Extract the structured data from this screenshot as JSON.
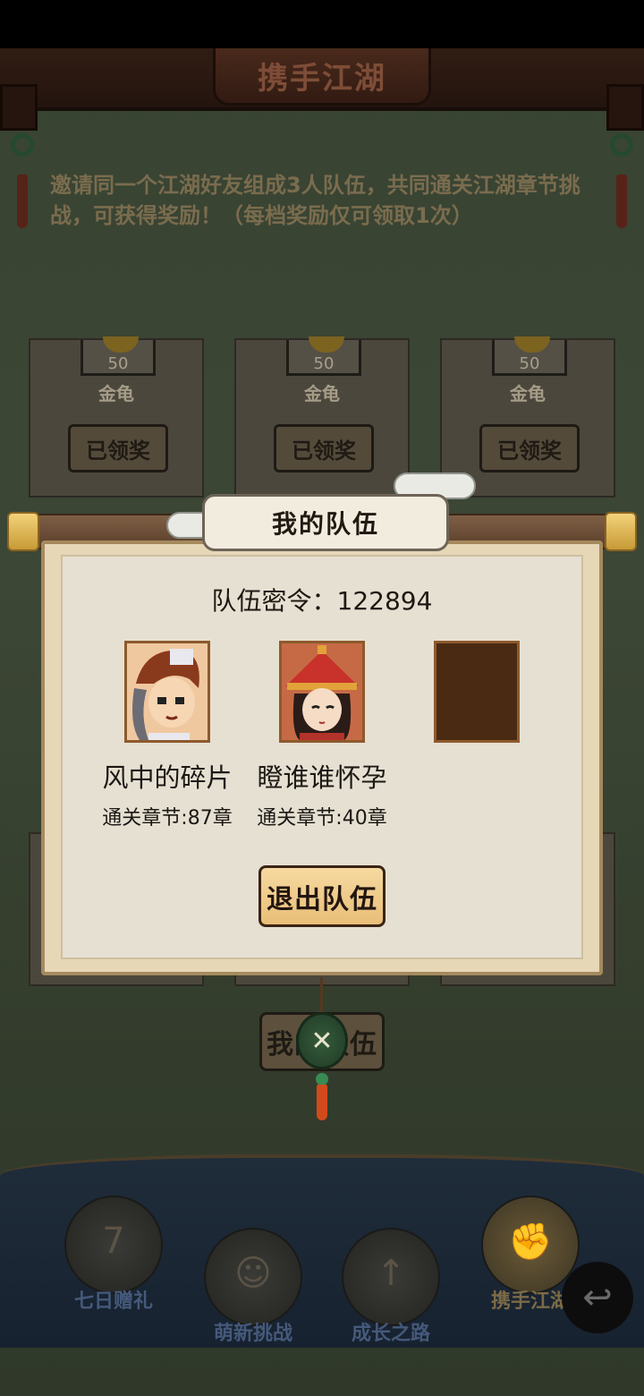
{
  "header": {
    "title": "携手江湖"
  },
  "intro_text": "邀请同一个江湖好友组成3人队伍，共同通关江湖章节挑战，可获得奖励！（每档奖励仅可领取1次）",
  "reward_cards": [
    {
      "qty": "50",
      "item": "金龟",
      "status": "已领奖"
    },
    {
      "qty": "50",
      "item": "金龟",
      "status": "已领奖"
    },
    {
      "qty": "50",
      "item": "金龟",
      "status": "已领奖"
    }
  ],
  "modal": {
    "title": "我的队伍",
    "team_code": "队伍密令：122894",
    "members": [
      {
        "name": "风中的碎片",
        "chapter": "通关章节:87章",
        "avatar": "boy-warrior-avatar"
      },
      {
        "name": "瞪谁谁怀孕",
        "chapter": "通关章节:40章",
        "avatar": "girl-red-hat-avatar"
      },
      {
        "name": "",
        "chapter": "",
        "avatar": "empty-slot"
      }
    ],
    "exit_button": "退出队伍"
  },
  "background_button": "我的队伍",
  "bottom_nav": [
    {
      "label": "七日赠礼",
      "icon": "gift-box-icon"
    },
    {
      "label": "萌新挑战",
      "icon": "mask-icon"
    },
    {
      "label": "成长之路",
      "icon": "book-arrow-icon"
    },
    {
      "label": "携手江湖",
      "icon": "handshake-icon",
      "active": true
    }
  ],
  "colors": {
    "modal_bg": "#e6e0d2",
    "accent_button": "#f6d9a0",
    "scroll_rod": "#7e5f45",
    "frame_brown": "#8d5a2c"
  }
}
